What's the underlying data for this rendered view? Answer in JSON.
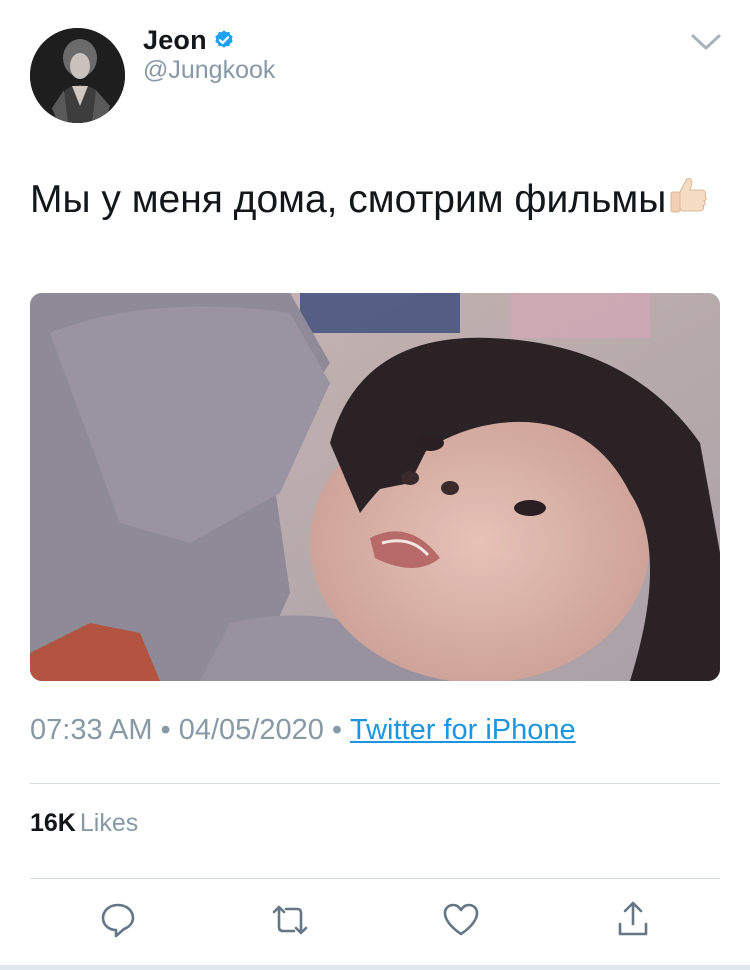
{
  "user": {
    "display_name": "Jeon",
    "handle": "@Jungkook",
    "verified": true,
    "avatar_icon": "profile-photo"
  },
  "tweet": {
    "text": "Мы у меня дома, смотрим фильмы",
    "emoji_icon": "thumbs-up-emoji",
    "media_icon": "photo-attachment"
  },
  "meta": {
    "time": "07:33 AM",
    "separator": "•",
    "date": "04/05/2020",
    "source": "Twitter for iPhone"
  },
  "stats": {
    "likes_count": "16K",
    "likes_label": "Likes"
  },
  "actions": [
    {
      "name": "reply",
      "icon": "speech-bubble-icon"
    },
    {
      "name": "retweet",
      "icon": "retweet-icon"
    },
    {
      "name": "like",
      "icon": "heart-icon"
    },
    {
      "name": "share",
      "icon": "share-icon"
    }
  ],
  "colors": {
    "text": "#14171a",
    "secondary": "#8899a6",
    "link": "#1b95e0",
    "verified": "#1da1f2",
    "divider": "#d6dce1"
  }
}
